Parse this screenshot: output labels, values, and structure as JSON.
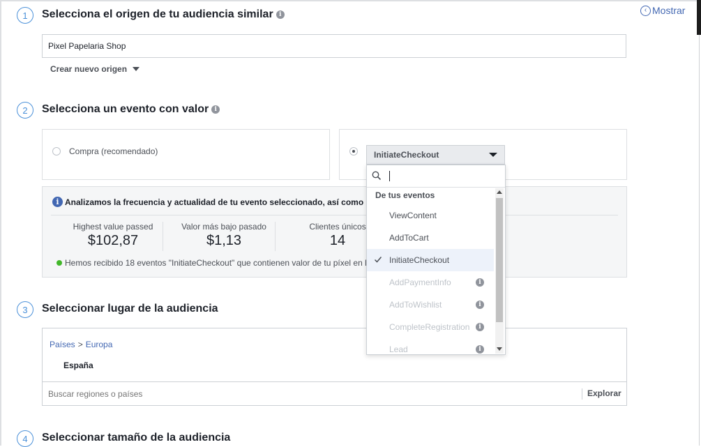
{
  "header": {
    "show_link": "Mostrar"
  },
  "step1": {
    "number": "1",
    "title": "Selecciona el origen de tu audiencia similar",
    "source_value": "Pixel Papelaria Shop",
    "create_origin": "Crear nuevo origen"
  },
  "step2": {
    "number": "2",
    "title": "Selecciona un evento con valor",
    "option_purchase": "Compra (recomendado)",
    "selected_event": "InitiateCheckout",
    "info_text": "Analizamos la frecuencia y actualidad de tu evento seleccionado, así como l",
    "stats": [
      {
        "label": "Highest value passed",
        "value": "$102,87"
      },
      {
        "label": "Valor más bajo pasado",
        "value": "$1,13"
      },
      {
        "label": "Clientes únicos",
        "value": "14"
      }
    ],
    "received_text": "Hemos recibido 18 eventos \"InitiateCheckout\" que contienen valor de tu píxel en l"
  },
  "step3": {
    "number": "3",
    "title": "Seleccionar lugar de la audiencia",
    "breadcrumb_countries": "Países",
    "breadcrumb_sep": ">",
    "breadcrumb_region": "Europa",
    "country": "España",
    "search_placeholder": "Buscar regiones o países",
    "explore": "Explorar"
  },
  "step4": {
    "number": "4",
    "title": "Seleccionar tamaño de la audiencia"
  },
  "dropdown": {
    "search_value": "",
    "group_label": "De tus eventos",
    "items": [
      {
        "label": "ViewContent",
        "state": "enabled"
      },
      {
        "label": "AddToCart",
        "state": "enabled"
      },
      {
        "label": "InitiateCheckout",
        "state": "selected"
      },
      {
        "label": "AddPaymentInfo",
        "state": "disabled"
      },
      {
        "label": "AddToWishlist",
        "state": "disabled"
      },
      {
        "label": "CompleteRegistration",
        "state": "disabled"
      },
      {
        "label": "Lead",
        "state": "disabled"
      }
    ]
  },
  "icons": {
    "info": "info-icon",
    "search": "search-icon",
    "check": "check-icon",
    "chevron_left": "chevron-left-icon",
    "caret_down": "caret-down-icon"
  },
  "colors": {
    "accent_blue": "#4267b2",
    "step_blue": "#4a90d9",
    "success_green": "#42b72a",
    "text_dark": "#1d2129",
    "text_gray": "#4b4f56",
    "disabled": "#bec3c9"
  }
}
